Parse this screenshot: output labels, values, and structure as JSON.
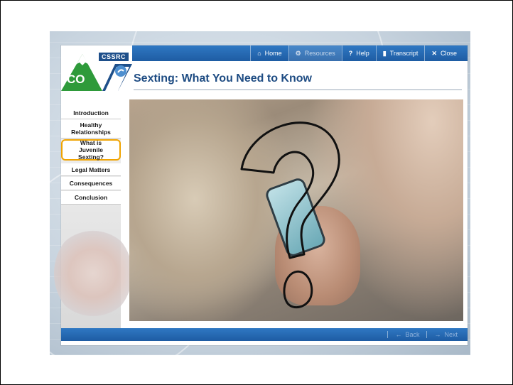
{
  "toolbar": {
    "home_label": "Home",
    "resources_label": "Resources",
    "help_label": "Help",
    "transcript_label": "Transcript",
    "close_label": "Close"
  },
  "logo": {
    "org": "CSSRC",
    "state": "CO"
  },
  "page_title": "Sexting: What You Need to Know",
  "sidebar": {
    "items": [
      {
        "label": "Introduction"
      },
      {
        "label": "Healthy Relationships"
      },
      {
        "label": "What is Juvenile Sexting?"
      },
      {
        "label": "Legal Matters"
      },
      {
        "label": "Consequences"
      },
      {
        "label": "Conclusion"
      }
    ],
    "selected_index": 2
  },
  "footer": {
    "back_label": "Back",
    "next_label": "Next"
  },
  "colors": {
    "accent": "#1e5ca3",
    "title": "#1e4c83",
    "selected_outline": "#f0a300"
  },
  "icons": [
    "home-icon",
    "gear-icon",
    "help-icon",
    "transcript-icon",
    "close-icon",
    "back-arrow-icon",
    "next-arrow-icon"
  ]
}
